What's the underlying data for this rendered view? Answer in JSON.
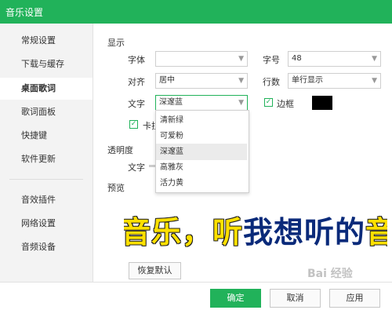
{
  "window": {
    "title": "音乐设置"
  },
  "sidebar": {
    "items": [
      {
        "label": "常规设置"
      },
      {
        "label": "下载与缓存"
      },
      {
        "label": "桌面歌词"
      },
      {
        "label": "歌词面板"
      },
      {
        "label": "快捷键"
      },
      {
        "label": "软件更新"
      },
      {
        "label": "音效插件"
      },
      {
        "label": "网络设置"
      },
      {
        "label": "音频设备"
      }
    ],
    "active_index": 2
  },
  "display": {
    "section_label": "显示",
    "font_label": "字体",
    "font_value": "",
    "size_label": "字号",
    "size_value": "48",
    "align_label": "对齐",
    "align_value": "居中",
    "lines_label": "行数",
    "lines_value": "单行显示",
    "text_label": "文字",
    "text_value": "深邃蓝",
    "border_label": "边框",
    "border_checked": true,
    "border_color": "#000000",
    "karaoke_label": "卡拉",
    "karaoke_checked": true
  },
  "dropdown": {
    "options": [
      "清新绿",
      "可爱粉",
      "深邃蓝",
      "高雅灰",
      "活力黄"
    ],
    "highlighted_index": 2
  },
  "opacity": {
    "section_label": "透明度",
    "text_label": "文字"
  },
  "preview": {
    "section_label": "预览",
    "lyric_part1": "音乐，听",
    "lyric_part2": "我想听的",
    "lyric_part3": "音"
  },
  "buttons": {
    "restore": "恢复默认",
    "ok": "确定",
    "cancel": "取消",
    "apply": "应用"
  },
  "watermark": "Bai 经验",
  "colors": {
    "accent": "#21b25a",
    "lyric_highlight": "#ffe000",
    "lyric_dark": "#0a2a7a"
  }
}
